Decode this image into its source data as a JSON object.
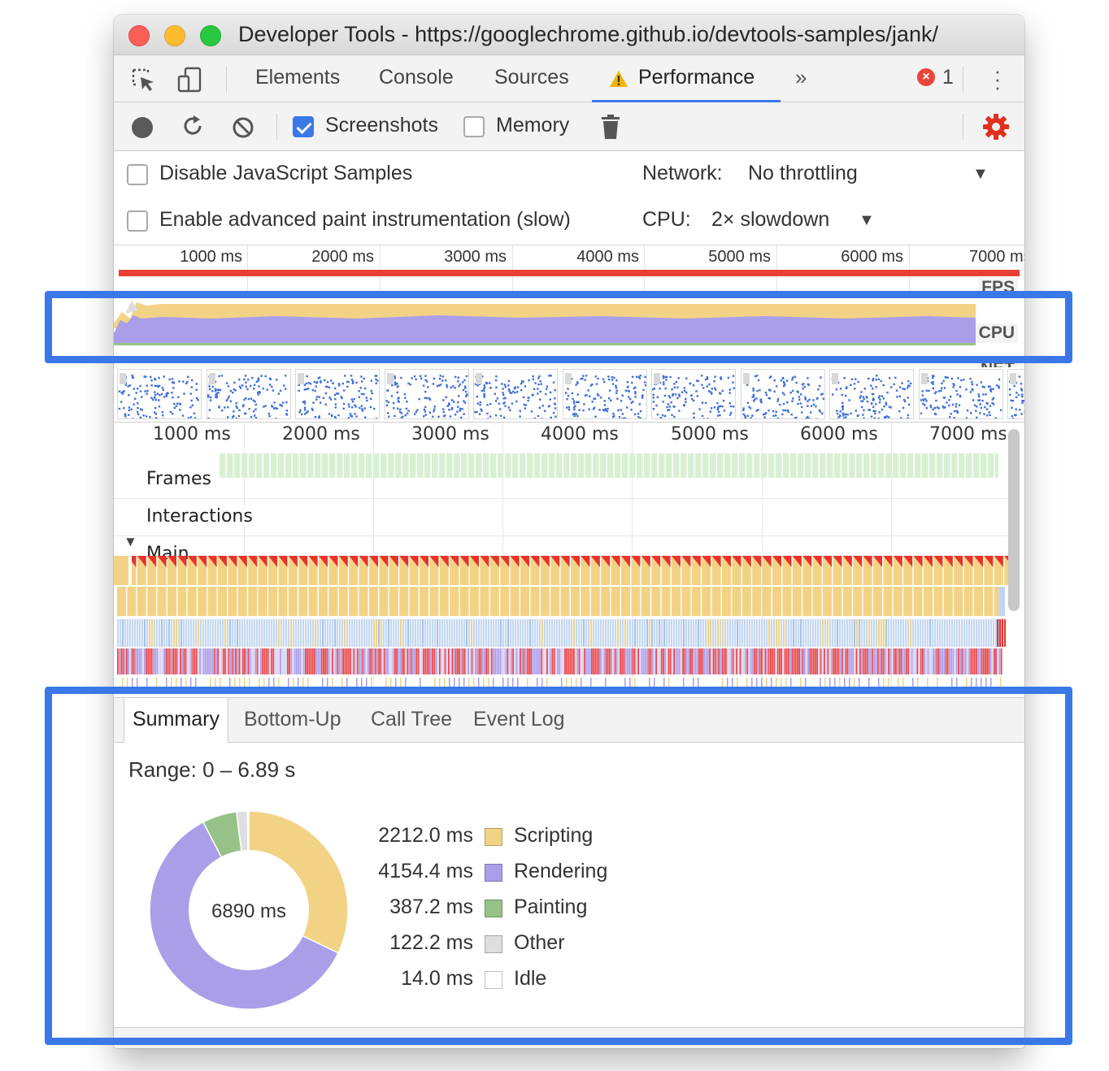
{
  "window": {
    "title": "Developer Tools - https://googlechrome.github.io/devtools-samples/jank/"
  },
  "panel_tabs": [
    {
      "label": "Elements"
    },
    {
      "label": "Console"
    },
    {
      "label": "Sources"
    },
    {
      "label": "Performance",
      "active": true
    }
  ],
  "tabbar": {
    "more_label": "»",
    "error_count": "1"
  },
  "toolbar": {
    "screenshots_label": "Screenshots",
    "screenshots_checked": true,
    "memory_label": "Memory",
    "memory_checked": false
  },
  "settings": {
    "disable_js_samples_label": "Disable JavaScript Samples",
    "advanced_paint_label": "Enable advanced paint instrumentation (slow)",
    "network_label": "Network:",
    "network_value": "No throttling",
    "cpu_label": "CPU:",
    "cpu_value": "2× slowdown"
  },
  "overview": {
    "ticks": [
      "1000 ms",
      "2000 ms",
      "3000 ms",
      "4000 ms",
      "5000 ms",
      "6000 ms",
      "7000 ms"
    ],
    "fps_label": "FPS",
    "cpu_label": "CPU",
    "net_label": "NET"
  },
  "timeline": {
    "ticks": [
      "1000 ms",
      "2000 ms",
      "3000 ms",
      "4000 ms",
      "5000 ms",
      "6000 ms",
      "7000 ms"
    ],
    "tracks": {
      "frames": "Frames",
      "interactions": "Interactions",
      "main": "Main"
    }
  },
  "bottom_tabs": [
    {
      "label": "Summary",
      "active": true
    },
    {
      "label": "Bottom-Up"
    },
    {
      "label": "Call Tree"
    },
    {
      "label": "Event Log"
    }
  ],
  "summary": {
    "range": "Range: 0 – 6.89 s",
    "total": "6890 ms",
    "items": [
      {
        "value": "2212.0 ms",
        "name": "Scripting",
        "ms": 2212.0,
        "color": "#f2d385"
      },
      {
        "value": "4154.4 ms",
        "name": "Rendering",
        "ms": 4154.4,
        "color": "#ab9ee9"
      },
      {
        "value": "387.2 ms",
        "name": "Painting",
        "ms": 387.2,
        "color": "#96c287"
      },
      {
        "value": "122.2 ms",
        "name": "Other",
        "ms": 122.2,
        "color": "#dedede"
      },
      {
        "value": "14.0 ms",
        "name": "Idle",
        "ms": 14.0,
        "color": "#ffffff"
      }
    ]
  },
  "colors": {
    "scripting": "#f2d385",
    "rendering": "#ab9ee9",
    "painting": "#96c287",
    "fps_red": "#e84035",
    "accent": "#3b78e7",
    "highlight": "#3a78e8"
  }
}
